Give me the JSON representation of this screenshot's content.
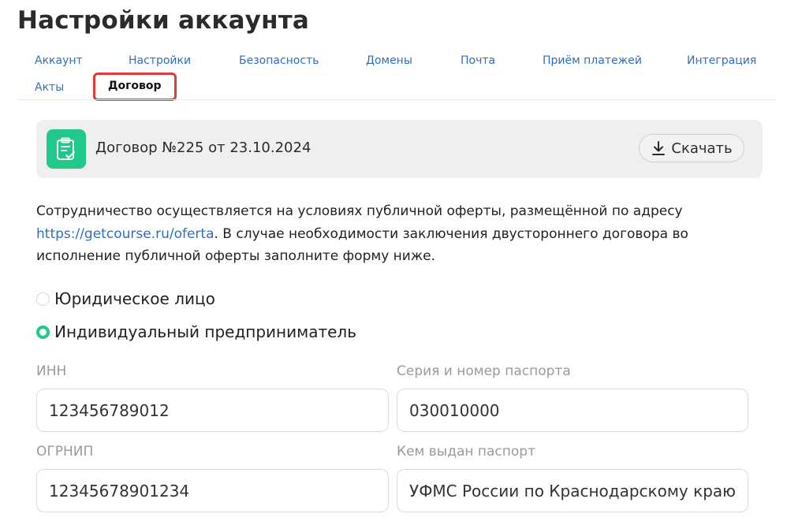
{
  "page": {
    "title": "Настройки аккаунта"
  },
  "tabs": [
    {
      "label": "Аккаунт"
    },
    {
      "label": "Настройки"
    },
    {
      "label": "Безопасность"
    },
    {
      "label": "Домены"
    },
    {
      "label": "Почта"
    },
    {
      "label": "Приём платежей"
    },
    {
      "label": "Интеграция"
    },
    {
      "label": "Акты"
    },
    {
      "label": "Договор",
      "active": true
    }
  ],
  "contract": {
    "title": "Договор №225 от 23.10.2024",
    "icon": "clipboard-check-icon",
    "download_label": "Скачать",
    "download_icon": "download-icon"
  },
  "intro": {
    "line1": "Сотрудничество осуществляется на условиях публичной оферты, размещённой по адресу",
    "link": "https://getcourse.ru/oferta",
    "line2_rest": ". В случае необходимости заключения двустороннего договора во",
    "line3": "исполнение публичной оферты заполните форму ниже."
  },
  "entity_type": {
    "options": [
      {
        "label": "Юридическое лицо",
        "checked": false
      },
      {
        "label": "Индивидуальный предприниматель",
        "checked": true
      }
    ]
  },
  "form": {
    "inn": {
      "label": "ИНН",
      "value": "123456789012"
    },
    "passport_number": {
      "label": "Серия и номер паспорта",
      "value": "030010000"
    },
    "ogrnip": {
      "label": "ОГРНИП",
      "value": "12345678901234"
    },
    "passport_issued_by": {
      "label": "Кем выдан паспорт",
      "value": "УФМС России по Краснодарскому краю"
    }
  },
  "colors": {
    "accent": "#20c98a",
    "link": "#2f6fbe",
    "active_tab_outline": "#e03a3a"
  }
}
